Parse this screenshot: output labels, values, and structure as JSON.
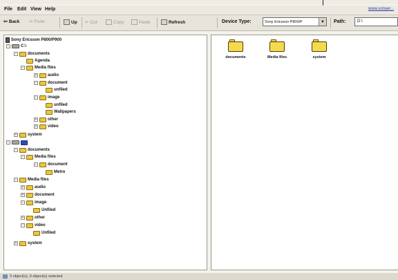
{
  "menu": {
    "items": [
      "File",
      "Edit",
      "View",
      "Help"
    ],
    "link": "www.sonyer..."
  },
  "toolbar": {
    "back": "Back",
    "forward": "Forw",
    "up": "Up",
    "cut": "Cut",
    "copy": "Copy",
    "paste": "Paste",
    "refresh": "Refresh",
    "device_type_label": "Device Type:",
    "device_type_value": "Sony Ericsson P800/P",
    "path_label": "Path:",
    "path_value": "D:\\"
  },
  "tree": {
    "root": "Sony Ericsson P800/P900",
    "drive_c": "C:\\",
    "drive_d": "D:\\",
    "labels": {
      "documents": "documents",
      "agenda": "Agenda",
      "media_files": "Media files",
      "audio": "audio",
      "document": "document",
      "unfiled": "unfiled",
      "image": "image",
      "wallpapers": "Wallpapers",
      "other": "other",
      "video": "video",
      "system": "system",
      "metro": "Metro",
      "unfiled_cap": "Unfiled"
    }
  },
  "right_pane": {
    "items": [
      "documents",
      "Media files",
      "system"
    ]
  },
  "status": {
    "text": "3 object(s), 0 object(s) selected"
  }
}
